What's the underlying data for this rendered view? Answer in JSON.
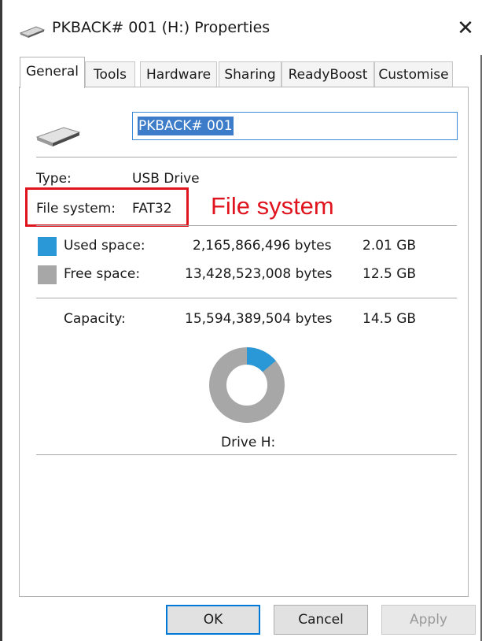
{
  "window": {
    "title": "PKBACK# 001 (H:) Properties",
    "close_glyph": "✕"
  },
  "tabs": [
    {
      "label": "General",
      "active": true
    },
    {
      "label": "Tools"
    },
    {
      "label": "Hardware"
    },
    {
      "label": "Sharing"
    },
    {
      "label": "ReadyBoost"
    },
    {
      "label": "Customise"
    }
  ],
  "general": {
    "drive_name": "PKBACK# 001",
    "type_label": "Type:",
    "type_value": "USB Drive",
    "fs_label": "File system:",
    "fs_value": "FAT32",
    "annotation": "File system",
    "used_label": "Used space:",
    "used_bytes": "2,165,866,496 bytes",
    "used_size": "2.01 GB",
    "free_label": "Free space:",
    "free_bytes": "13,428,523,008 bytes",
    "free_size": "12.5 GB",
    "capacity_label": "Capacity:",
    "capacity_bytes": "15,594,389,504 bytes",
    "capacity_size": "14.5 GB",
    "drive_caption": "Drive H:",
    "used_fraction": 0.139
  },
  "colors": {
    "used": "#2a97d6",
    "free": "#a7a7a7",
    "annotation": "#e0141e"
  },
  "buttons": {
    "ok": "OK",
    "cancel": "Cancel",
    "apply": "Apply"
  }
}
